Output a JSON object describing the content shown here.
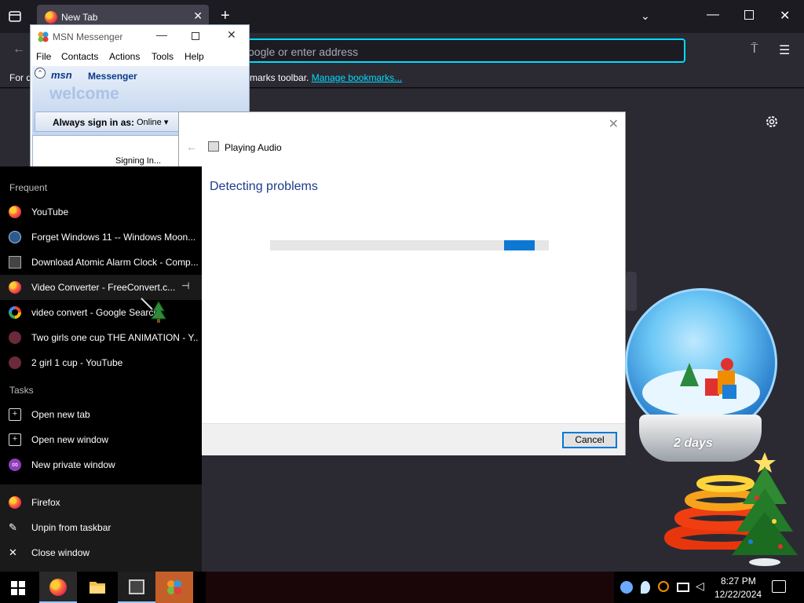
{
  "firefox": {
    "tab_title": "New Tab",
    "tab_close": "✕",
    "new_tab": "+",
    "list_tabs": "⌄",
    "minimize": "—",
    "close": "✕",
    "back": "←",
    "url_placeholder": "oogle or enter address",
    "extensions": "⍑",
    "menu": "☰",
    "bookmarks_left": "For q",
    "bookmarks_right": "marks toolbar.",
    "bookmarks_link": "Manage bookmarks...",
    "accent_color": "#00ddff"
  },
  "msn": {
    "title": "MSN Messenger",
    "menu": [
      "File",
      "Contacts",
      "Actions",
      "Tools",
      "Help"
    ],
    "logo": "msn",
    "logo_word": "Messenger",
    "welcome": "welcome",
    "signin_label": "Always sign in as:",
    "signin_value": "Online ▾",
    "status": "Signing In...",
    "minimize": "—",
    "close": "✕",
    "collapse": "⌃"
  },
  "dialog": {
    "close": "✕",
    "back": "←",
    "app_title": "Playing Audio",
    "heading": "Detecting problems",
    "progress_fraction_start": 0.84,
    "progress_fraction_width": 0.11,
    "cancel": "Cancel"
  },
  "jumplist": {
    "frequent_label": "Frequent",
    "frequent": [
      {
        "label": "YouTube",
        "icon": "firefox-icon"
      },
      {
        "label": "Forget Windows 11 -- Windows Moon...",
        "icon": "globe-icon"
      },
      {
        "label": "Download Atomic Alarm Clock - Comp...",
        "icon": "keyboard-icon"
      },
      {
        "label": "Video Converter - FreeConvert.c...",
        "icon": "firefox-icon"
      },
      {
        "label": "video convert - Google Search",
        "icon": "google-icon"
      },
      {
        "label": "Two girls one cup THE ANIMATION - Y...",
        "icon": "video-icon"
      },
      {
        "label": "2 girl 1 cup - YouTube",
        "icon": "video-icon"
      }
    ],
    "pin_glyph": "⊣",
    "tasks_label": "Tasks",
    "tasks": [
      {
        "label": "Open new tab",
        "glyph": "+"
      },
      {
        "label": "Open new window",
        "glyph": "+"
      },
      {
        "label": "New private window",
        "glyph": "∞"
      }
    ],
    "app": [
      {
        "label": "Firefox",
        "glyph": ""
      },
      {
        "label": "Unpin from taskbar",
        "glyph": "✎"
      },
      {
        "label": "Close window",
        "glyph": "✕"
      }
    ]
  },
  "decor": {
    "globe_label": "2 days"
  },
  "taskbar": {
    "time": "8:27 PM",
    "date": "12/22/2024",
    "apps": [
      "firefox",
      "file-explorer",
      "troubleshooter",
      "msn-messenger"
    ]
  }
}
